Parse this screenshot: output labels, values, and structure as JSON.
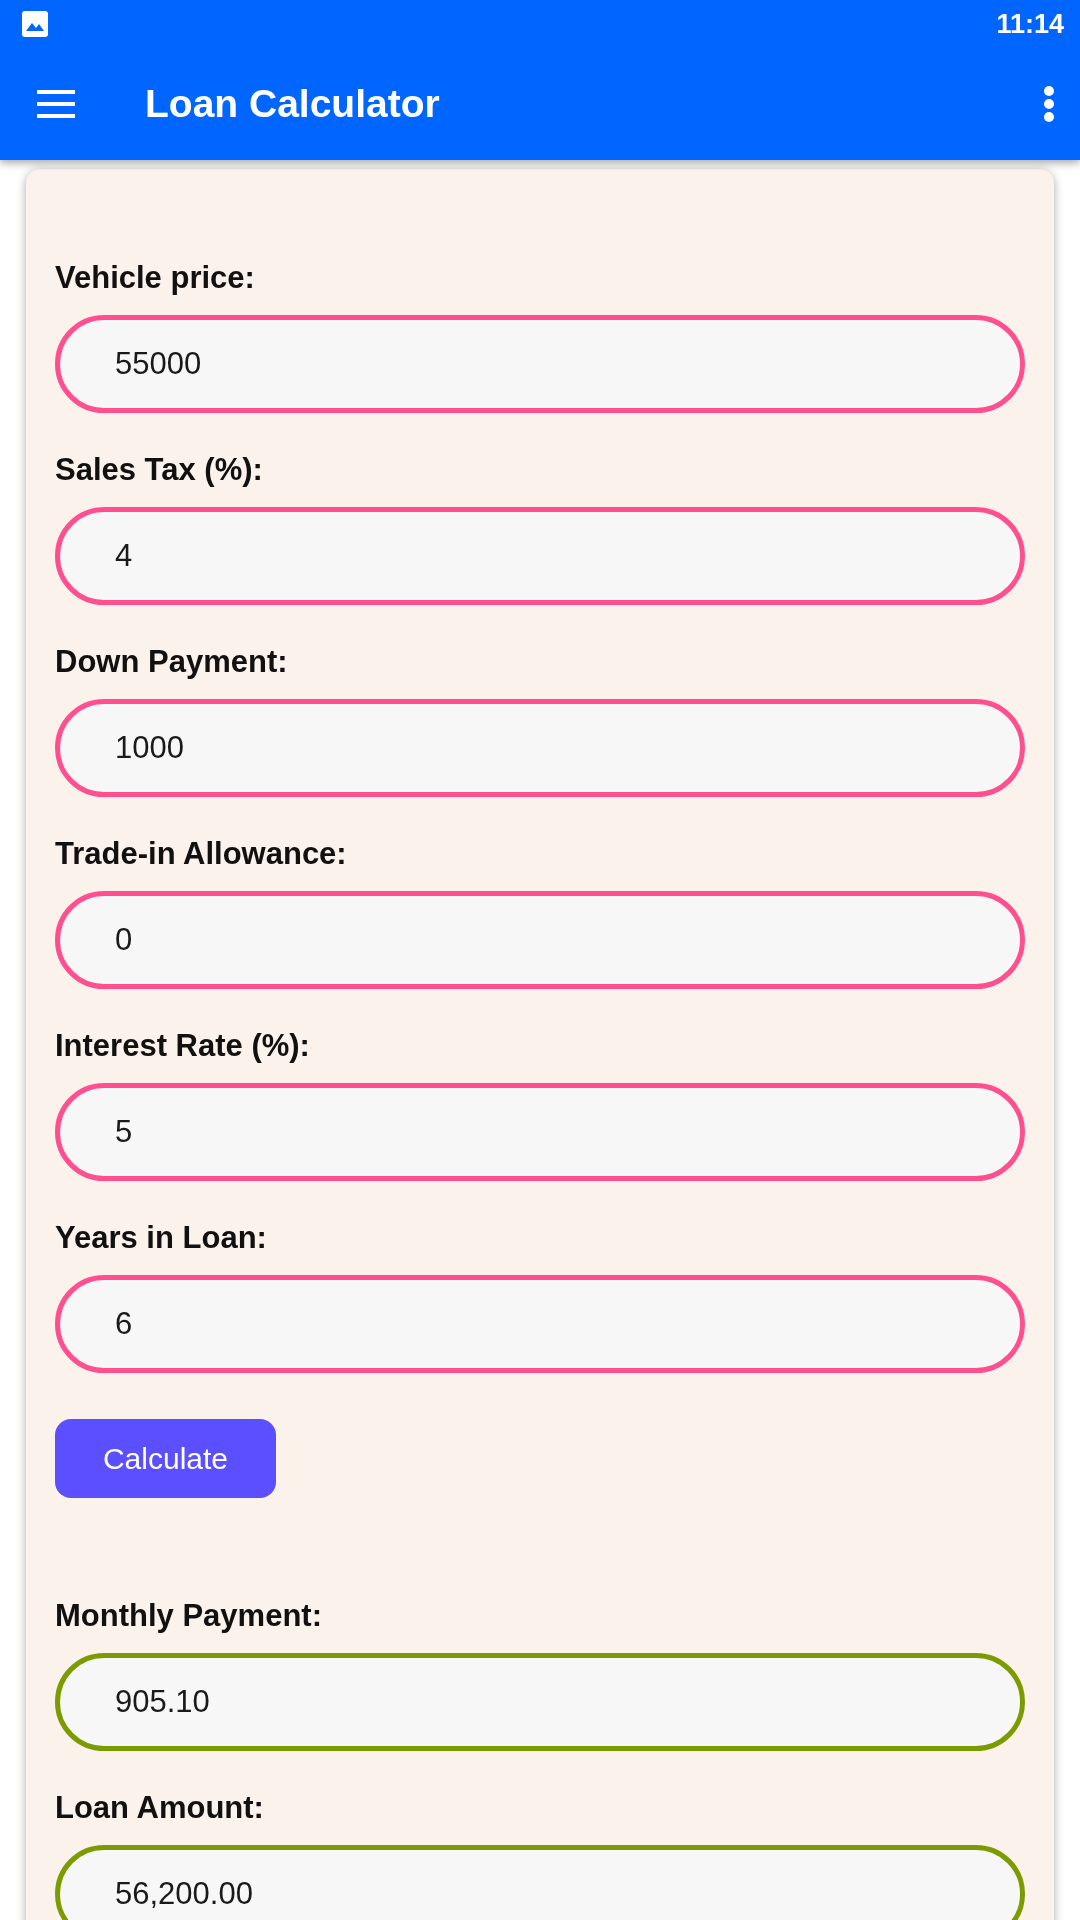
{
  "status_bar": {
    "time": "11:14"
  },
  "app_bar": {
    "title": "Loan Calculator"
  },
  "inputs": [
    {
      "label": "Vehicle price:",
      "value": "55000"
    },
    {
      "label": "Sales Tax (%):",
      "value": "4"
    },
    {
      "label": "Down Payment:",
      "value": "1000"
    },
    {
      "label": "Trade-in Allowance:",
      "value": "0"
    },
    {
      "label": "Interest Rate (%):",
      "value": "5"
    },
    {
      "label": "Years in Loan:",
      "value": "6"
    }
  ],
  "calculate_button": {
    "label": "Calculate"
  },
  "results": [
    {
      "label": "Monthly Payment:",
      "value": "905.10"
    },
    {
      "label": "Loan Amount:",
      "value": "56,200.00"
    }
  ]
}
